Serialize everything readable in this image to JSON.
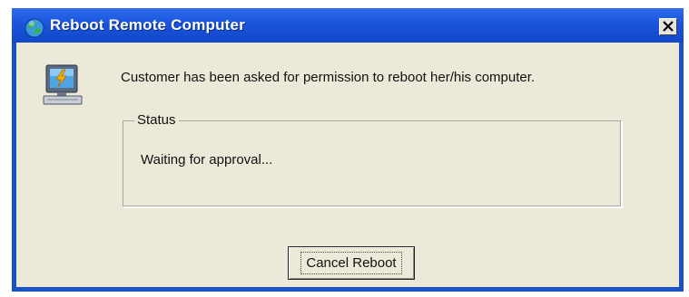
{
  "window": {
    "title": "Reboot Remote Computer",
    "title_icon": "globe-icon",
    "close_icon": "close-icon"
  },
  "dialog": {
    "icon": "computer-reboot-icon",
    "message": "Customer has been asked for permission to reboot her/his computer."
  },
  "status_group": {
    "label": "Status",
    "text": "Waiting for approval..."
  },
  "buttons": {
    "cancel_label": "Cancel Reboot"
  },
  "colors": {
    "titlebar": "#1a55dc",
    "client_bg": "#ece9d8",
    "title_text": "#ffffff"
  }
}
